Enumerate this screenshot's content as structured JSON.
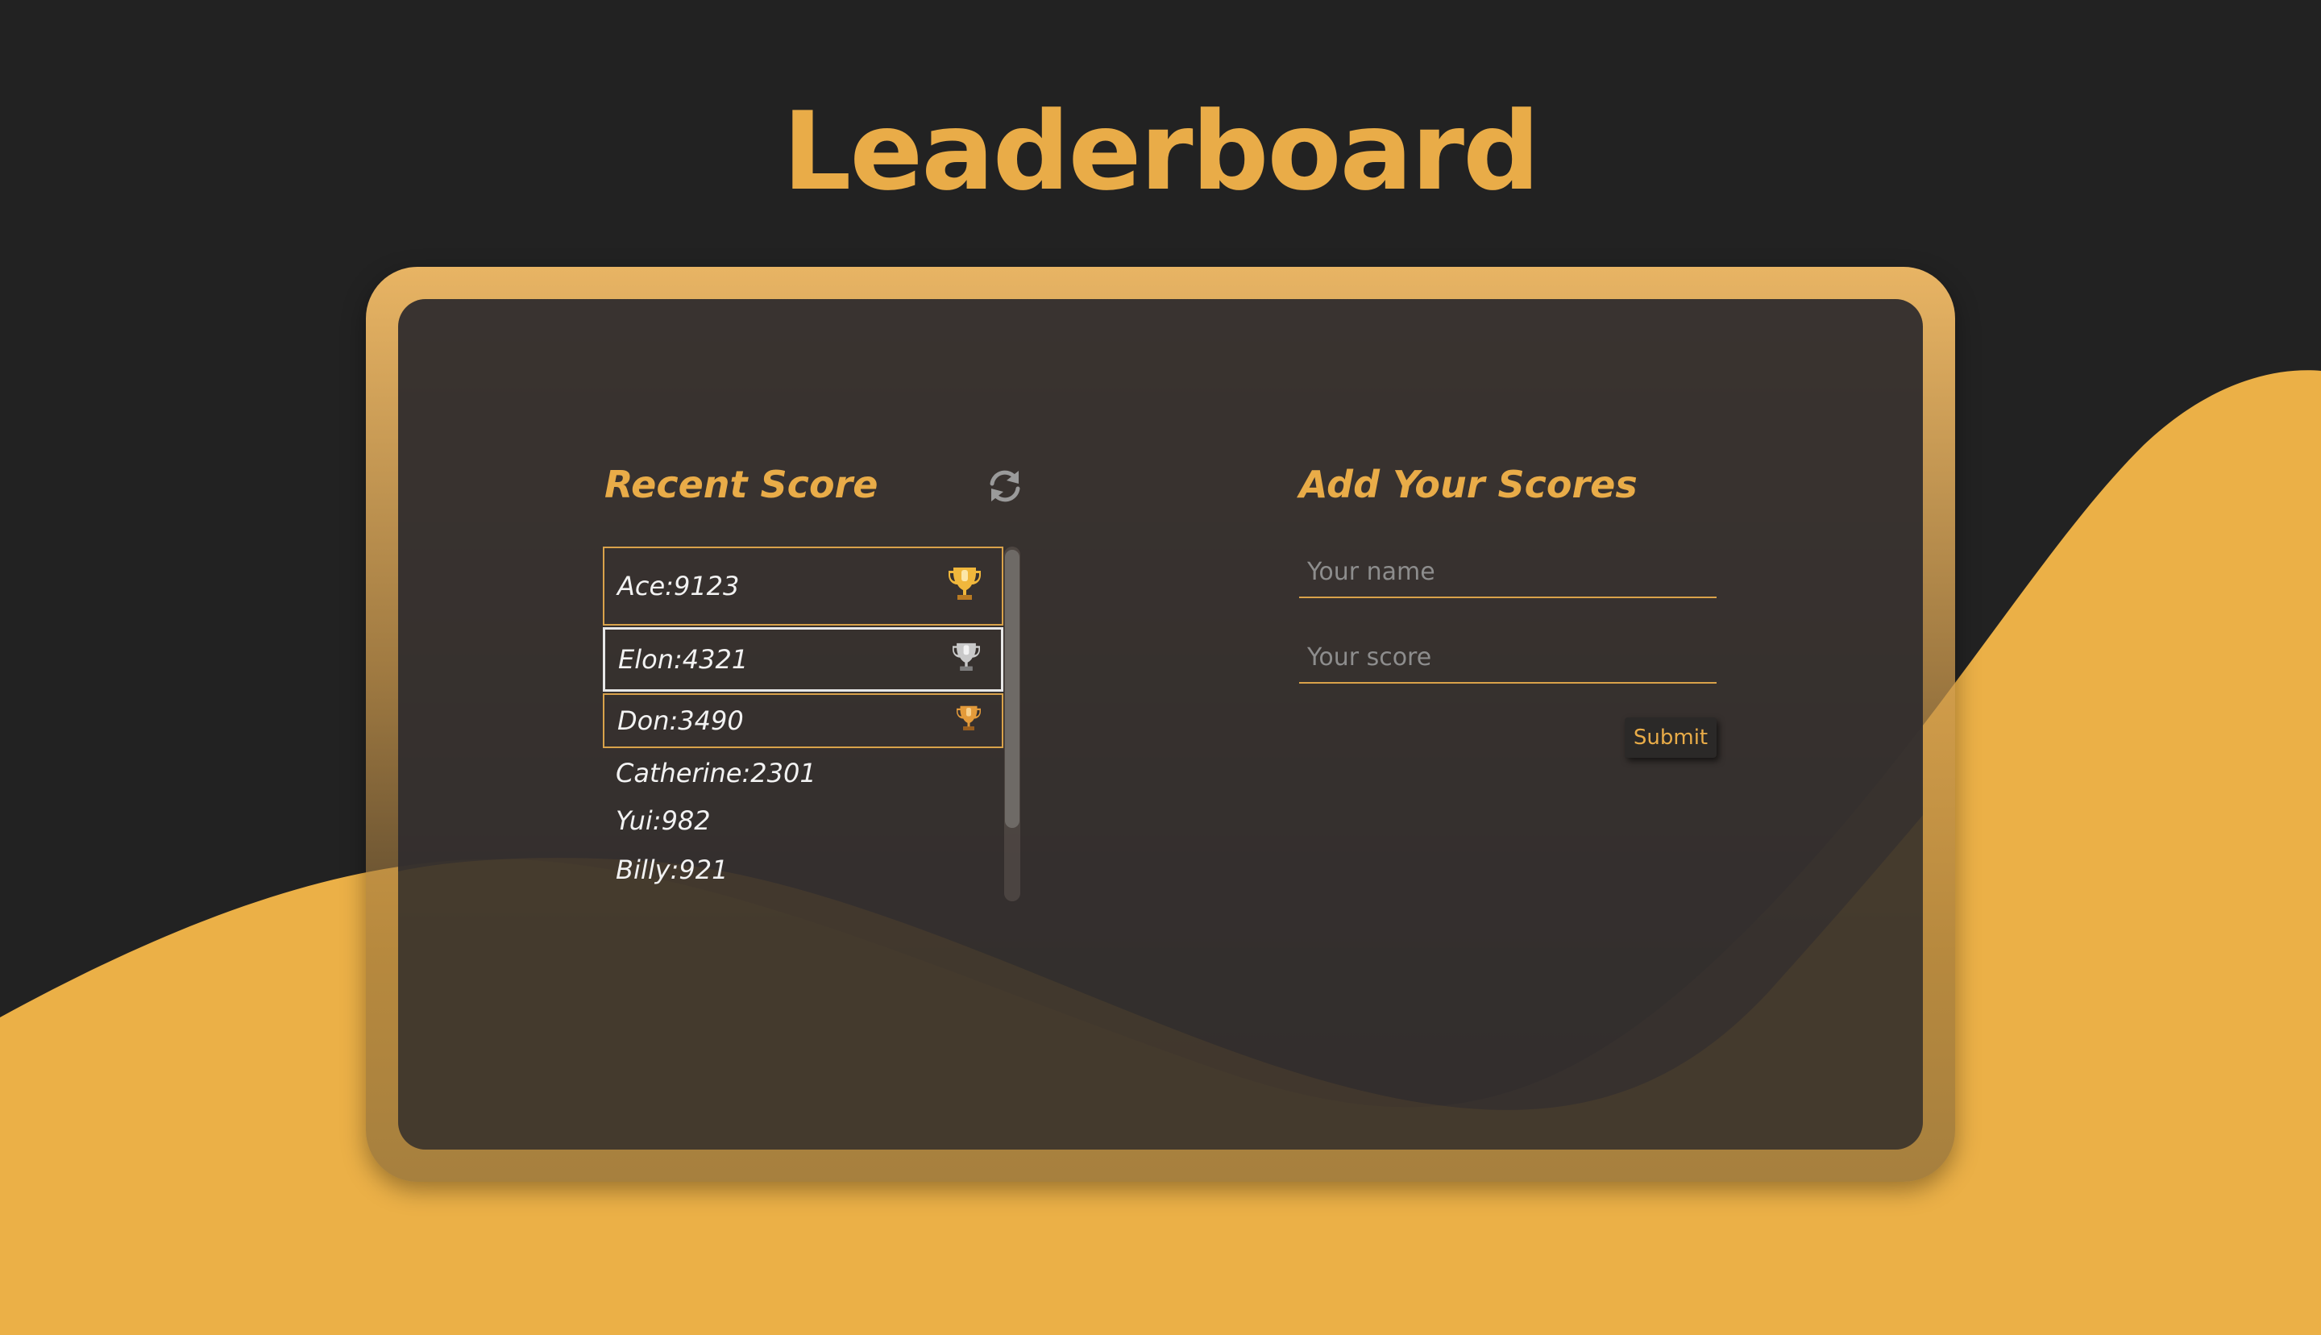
{
  "page": {
    "title": "Leaderboard"
  },
  "recent": {
    "title": "Recent Score",
    "refresh_icon": "refresh-icon",
    "scores": [
      {
        "label": "Ace:9123",
        "trophy": "gold-trophy-icon"
      },
      {
        "label": "Elon:4321",
        "trophy": "silver-trophy-icon"
      },
      {
        "label": "Don:3490",
        "trophy": "bronze-trophy-icon"
      },
      {
        "label": "Catherine:2301"
      },
      {
        "label": "Yui:982"
      },
      {
        "label": "Billy:921"
      }
    ]
  },
  "add": {
    "title": "Add Your Scores",
    "name_placeholder": "Your name",
    "name_value": "",
    "score_placeholder": "Your score",
    "score_value": "",
    "submit_label": "Submit"
  },
  "colors": {
    "background": "#222222",
    "accent": "#e9ac48",
    "card": "#322e2e",
    "gold": "#f0b73c",
    "silver": "#c9c9c9",
    "bronze": "#e39a3a"
  }
}
